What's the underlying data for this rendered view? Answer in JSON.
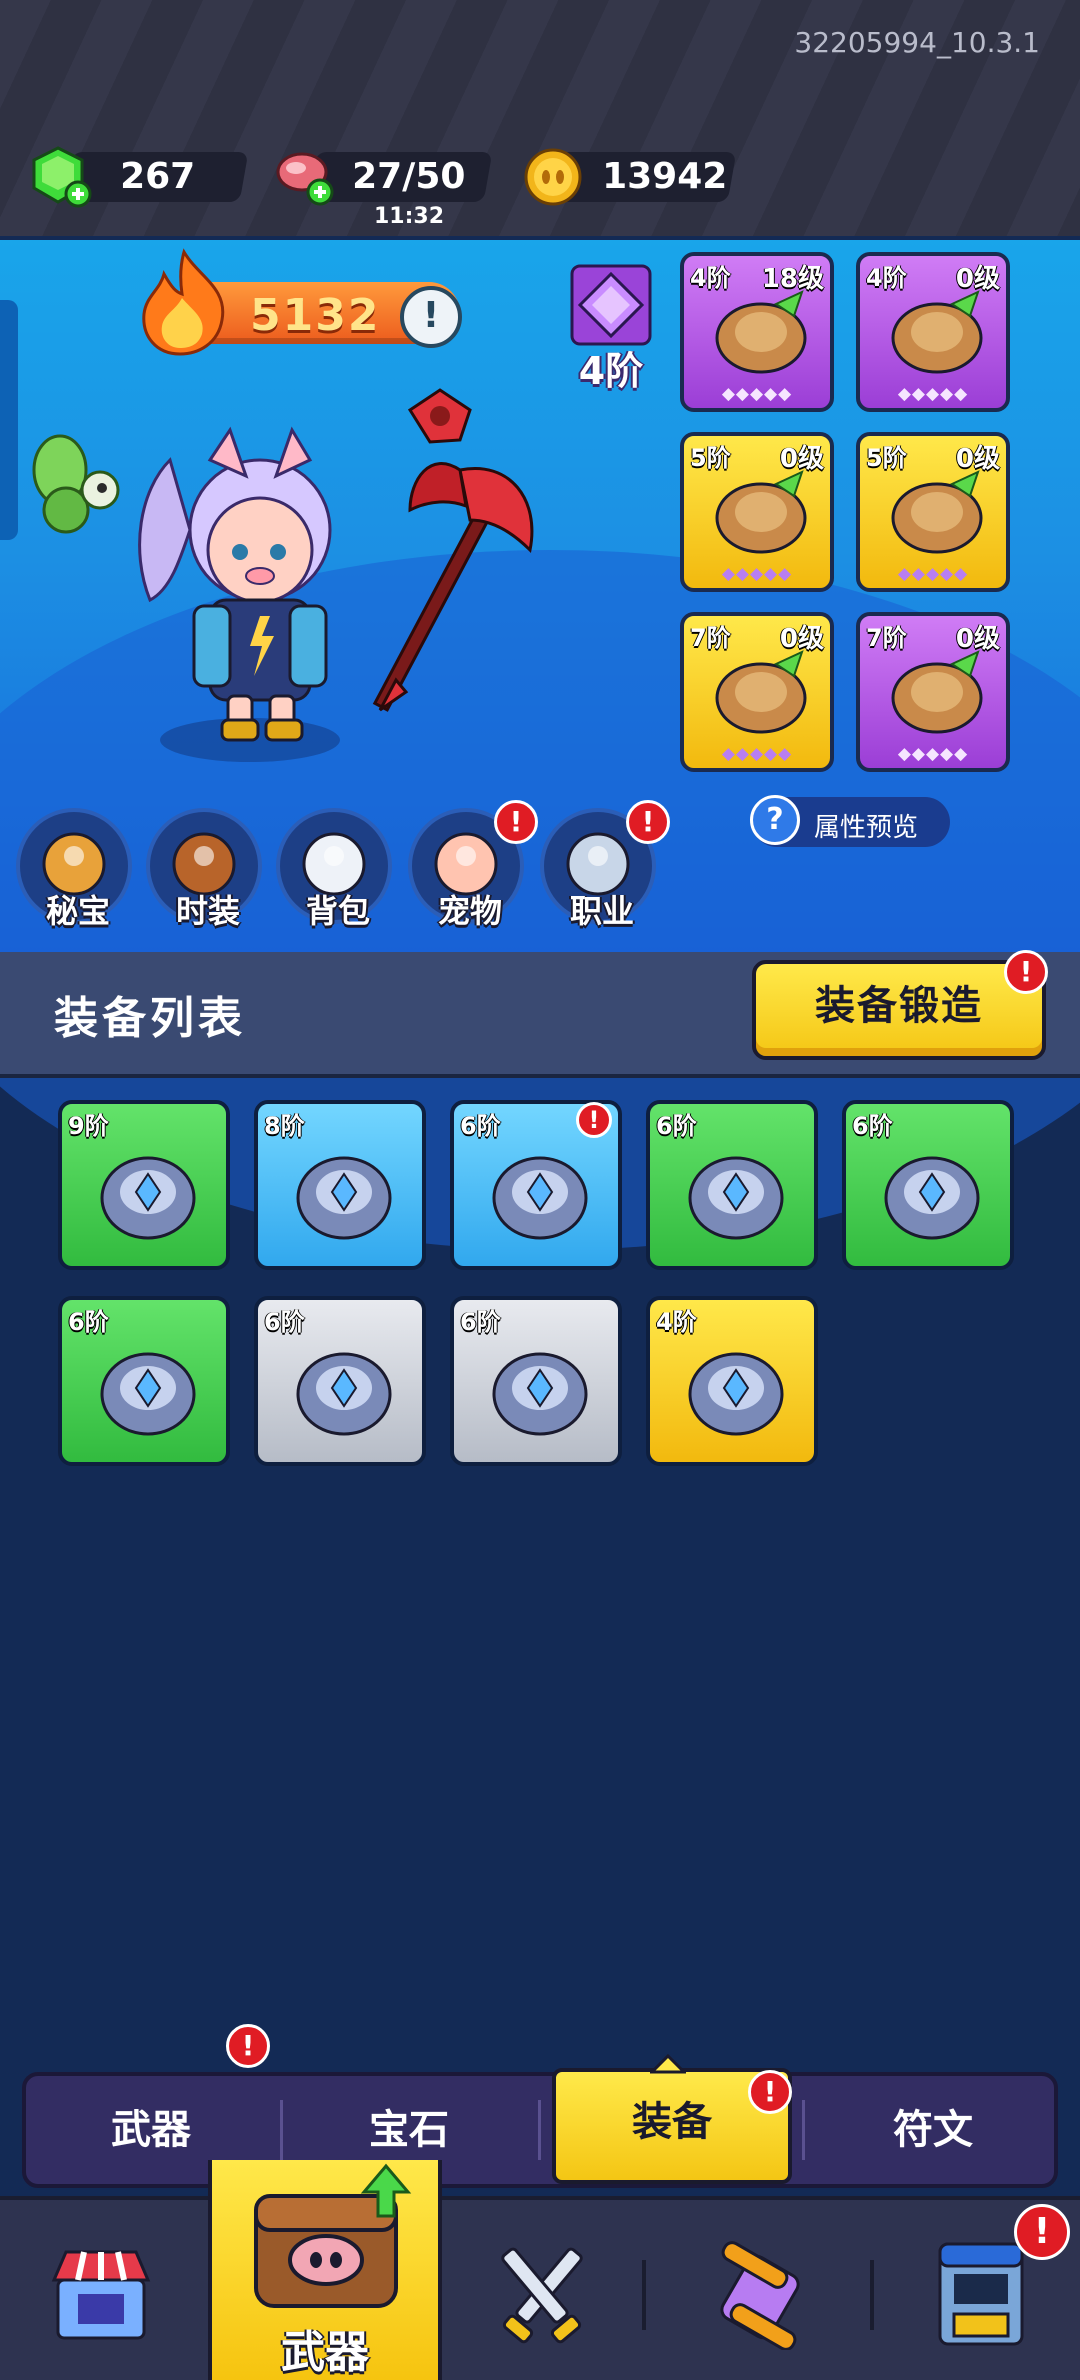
{
  "top": {
    "version": "32205994_10.3.1",
    "gems": "267",
    "stamina": "27/50",
    "stamina_timer": "11:32",
    "coins": "13942"
  },
  "hero": {
    "power": "5132",
    "badge_tier": "4阶",
    "attr_preview": "属性预览"
  },
  "slots": [
    {
      "tier": "4阶",
      "level": "18级",
      "color": "purple",
      "icon": "hat-icon"
    },
    {
      "tier": "4阶",
      "level": "0级",
      "color": "purple",
      "icon": "amulet-icon"
    },
    {
      "tier": "5阶",
      "level": "0级",
      "color": "yellow",
      "icon": "armor-icon"
    },
    {
      "tier": "5阶",
      "level": "0级",
      "color": "yellow",
      "icon": "bracer-icon"
    },
    {
      "tier": "7阶",
      "level": "0级",
      "color": "yellow",
      "icon": "pants-icon"
    },
    {
      "tier": "7阶",
      "level": "0级",
      "color": "purple",
      "icon": "boots-icon"
    }
  ],
  "shortcuts": [
    {
      "label": "秘宝",
      "icon": "treasure-icon",
      "alert": false
    },
    {
      "label": "时装",
      "icon": "fashion-hat-icon",
      "alert": false
    },
    {
      "label": "背包",
      "icon": "backpack-icon",
      "alert": false
    },
    {
      "label": "宠物",
      "icon": "pet-paw-icon",
      "alert": true
    },
    {
      "label": "职业",
      "icon": "class-sword-icon",
      "alert": true
    }
  ],
  "list": {
    "title": "装备列表",
    "forge": "装备锻造"
  },
  "items": [
    {
      "tier": "9阶",
      "color": "green",
      "icon": "purple-armor-icon",
      "alert": false
    },
    {
      "tier": "8阶",
      "color": "blue",
      "icon": "gold-bracer-icon",
      "alert": false
    },
    {
      "tier": "6阶",
      "color": "blue",
      "icon": "amulet-icon",
      "alert": true
    },
    {
      "tier": "6阶",
      "color": "green",
      "icon": "leaf-armor-icon",
      "alert": false
    },
    {
      "tier": "6阶",
      "color": "green",
      "icon": "bracer-icon",
      "alert": false
    },
    {
      "tier": "6阶",
      "color": "green",
      "icon": "pants-icon",
      "alert": false
    },
    {
      "tier": "6阶",
      "color": "gray",
      "icon": "amulet-icon",
      "alert": false
    },
    {
      "tier": "6阶",
      "color": "gray",
      "icon": "pants-icon",
      "alert": false
    },
    {
      "tier": "4阶",
      "color": "yellow",
      "icon": "boots-icon",
      "alert": false
    }
  ],
  "sub_tabs": [
    {
      "label": "武器",
      "alert": true
    },
    {
      "label": "宝石",
      "alert": false
    },
    {
      "label": "装备",
      "alert": true,
      "active": true
    },
    {
      "label": "符文",
      "alert": false
    }
  ],
  "nav": {
    "active_label": "武器"
  }
}
